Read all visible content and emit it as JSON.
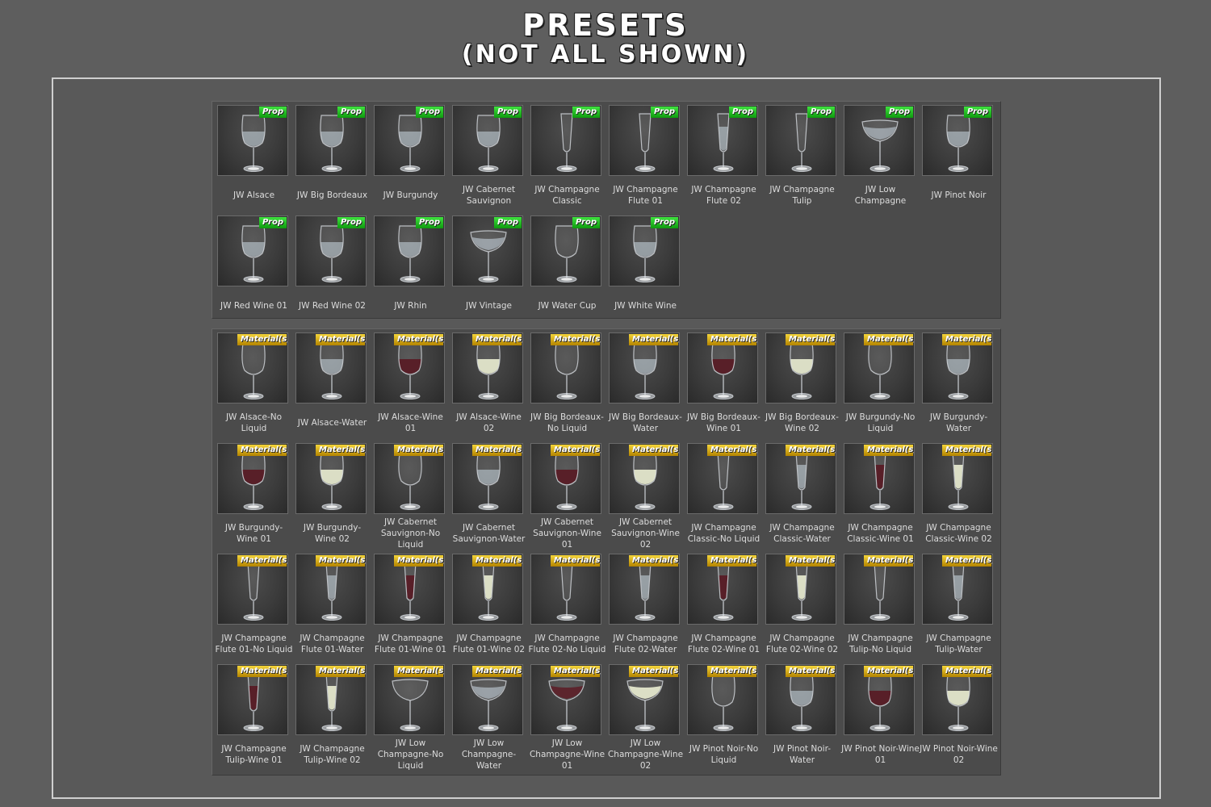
{
  "title": {
    "line1": "PRESETS",
    "line2": "(NOT ALL SHOWN)"
  },
  "colors": {
    "prop_badge": "#16b016",
    "material_badge": "#e0b010",
    "background": "#5e5e5e",
    "panel": "#4b4b4b"
  },
  "props": {
    "badge": "Prop",
    "items": [
      {
        "label": "JW Alsace",
        "icon": "wine-glass-icon",
        "liquid": "water"
      },
      {
        "label": "JW Big Bordeaux",
        "icon": "wine-glass-icon",
        "liquid": "water"
      },
      {
        "label": "JW Burgundy",
        "icon": "wine-glass-icon",
        "liquid": "water"
      },
      {
        "label": "JW Cabernet Sauvignon",
        "icon": "wine-glass-icon",
        "liquid": "water"
      },
      {
        "label": "JW Champagne Classic",
        "icon": "champagne-flute-icon",
        "liquid": "none"
      },
      {
        "label": "JW Champagne Flute 01",
        "icon": "champagne-flute-icon",
        "liquid": "none"
      },
      {
        "label": "JW Champagne Flute 02",
        "icon": "champagne-flute-icon",
        "liquid": "water"
      },
      {
        "label": "JW Champagne Tulip",
        "icon": "champagne-flute-icon",
        "liquid": "none"
      },
      {
        "label": "JW Low Champagne",
        "icon": "coupe-glass-icon",
        "liquid": "water"
      },
      {
        "label": "JW Pinot Noir",
        "icon": "wine-glass-icon",
        "liquid": "water"
      },
      {
        "label": "JW Red Wine 01",
        "icon": "wine-glass-icon",
        "liquid": "water"
      },
      {
        "label": "JW Red Wine 02",
        "icon": "wine-glass-icon",
        "liquid": "water"
      },
      {
        "label": "JW Rhin",
        "icon": "wine-glass-icon",
        "liquid": "water"
      },
      {
        "label": "JW Vintage",
        "icon": "coupe-glass-icon",
        "liquid": "water"
      },
      {
        "label": "JW Water Cup",
        "icon": "wine-glass-icon",
        "liquid": "none"
      },
      {
        "label": "JW White Wine",
        "icon": "wine-glass-icon",
        "liquid": "water"
      }
    ]
  },
  "materials": {
    "badge": "Material(s)",
    "items": [
      {
        "label": "JW Alsace-No Liquid",
        "icon": "wine-glass-icon",
        "liquid": "none"
      },
      {
        "label": "JW Alsace-Water",
        "icon": "wine-glass-icon",
        "liquid": "water"
      },
      {
        "label": "JW Alsace-Wine 01",
        "icon": "wine-glass-icon",
        "liquid": "red"
      },
      {
        "label": "JW Alsace-Wine 02",
        "icon": "wine-glass-icon",
        "liquid": "white"
      },
      {
        "label": "JW Big Bordeaux-No Liquid",
        "icon": "wine-glass-icon",
        "liquid": "none"
      },
      {
        "label": "JW Big Bordeaux-Water",
        "icon": "wine-glass-icon",
        "liquid": "water"
      },
      {
        "label": "JW Big Bordeaux-Wine 01",
        "icon": "wine-glass-icon",
        "liquid": "red"
      },
      {
        "label": "JW Big Bordeaux-Wine 02",
        "icon": "wine-glass-icon",
        "liquid": "white"
      },
      {
        "label": "JW Burgundy-No Liquid",
        "icon": "wine-glass-icon",
        "liquid": "none"
      },
      {
        "label": "JW Burgundy-Water",
        "icon": "wine-glass-icon",
        "liquid": "water"
      },
      {
        "label": "JW Burgundy-Wine 01",
        "icon": "wine-glass-icon",
        "liquid": "red"
      },
      {
        "label": "JW Burgundy-Wine 02",
        "icon": "wine-glass-icon",
        "liquid": "white"
      },
      {
        "label": "JW Cabernet Sauvignon-No Liquid",
        "icon": "wine-glass-icon",
        "liquid": "none"
      },
      {
        "label": "JW Cabernet Sauvignon-Water",
        "icon": "wine-glass-icon",
        "liquid": "water"
      },
      {
        "label": "JW Cabernet Sauvignon-Wine 01",
        "icon": "wine-glass-icon",
        "liquid": "red"
      },
      {
        "label": "JW Cabernet Sauvignon-Wine 02",
        "icon": "wine-glass-icon",
        "liquid": "white"
      },
      {
        "label": "JW Champagne Classic-No Liquid",
        "icon": "champagne-flute-icon",
        "liquid": "none"
      },
      {
        "label": "JW Champagne Classic-Water",
        "icon": "champagne-flute-icon",
        "liquid": "water"
      },
      {
        "label": "JW Champagne Classic-Wine 01",
        "icon": "champagne-flute-icon",
        "liquid": "red"
      },
      {
        "label": "JW Champagne Classic-Wine 02",
        "icon": "champagne-flute-icon",
        "liquid": "white"
      },
      {
        "label": "JW Champagne Flute 01-No Liquid",
        "icon": "champagne-flute-icon",
        "liquid": "none"
      },
      {
        "label": "JW Champagne Flute 01-Water",
        "icon": "champagne-flute-icon",
        "liquid": "water"
      },
      {
        "label": "JW Champagne Flute 01-Wine 01",
        "icon": "champagne-flute-icon",
        "liquid": "red"
      },
      {
        "label": "JW Champagne Flute 01-Wine 02",
        "icon": "champagne-flute-icon",
        "liquid": "white"
      },
      {
        "label": "JW Champagne Flute 02-No Liquid",
        "icon": "champagne-flute-icon",
        "liquid": "none"
      },
      {
        "label": "JW Champagne Flute 02-Water",
        "icon": "champagne-flute-icon",
        "liquid": "water"
      },
      {
        "label": "JW Champagne Flute 02-Wine 01",
        "icon": "champagne-flute-icon",
        "liquid": "red"
      },
      {
        "label": "JW Champagne Flute 02-Wine 02",
        "icon": "champagne-flute-icon",
        "liquid": "white"
      },
      {
        "label": "JW Champagne Tulip-No Liquid",
        "icon": "champagne-flute-icon",
        "liquid": "none"
      },
      {
        "label": "JW Champagne Tulip-Water",
        "icon": "champagne-flute-icon",
        "liquid": "water"
      },
      {
        "label": "JW Champagne Tulip-Wine 01",
        "icon": "champagne-flute-icon",
        "liquid": "red"
      },
      {
        "label": "JW Champagne Tulip-Wine 02",
        "icon": "champagne-flute-icon",
        "liquid": "white"
      },
      {
        "label": "JW Low Champagne-No Liquid",
        "icon": "coupe-glass-icon",
        "liquid": "none"
      },
      {
        "label": "JW Low Champagne-Water",
        "icon": "coupe-glass-icon",
        "liquid": "water"
      },
      {
        "label": "JW Low Champagne-Wine 01",
        "icon": "coupe-glass-icon",
        "liquid": "red"
      },
      {
        "label": "JW Low Champagne-Wine 02",
        "icon": "coupe-glass-icon",
        "liquid": "white"
      },
      {
        "label": "JW Pinot Noir-No Liquid",
        "icon": "wine-glass-icon",
        "liquid": "none"
      },
      {
        "label": "JW Pinot Noir-Water",
        "icon": "wine-glass-icon",
        "liquid": "water"
      },
      {
        "label": "JW Pinot Noir-Wine 01",
        "icon": "wine-glass-icon",
        "liquid": "red"
      },
      {
        "label": "JW Pinot Noir-Wine 02",
        "icon": "wine-glass-icon",
        "liquid": "white"
      }
    ]
  }
}
